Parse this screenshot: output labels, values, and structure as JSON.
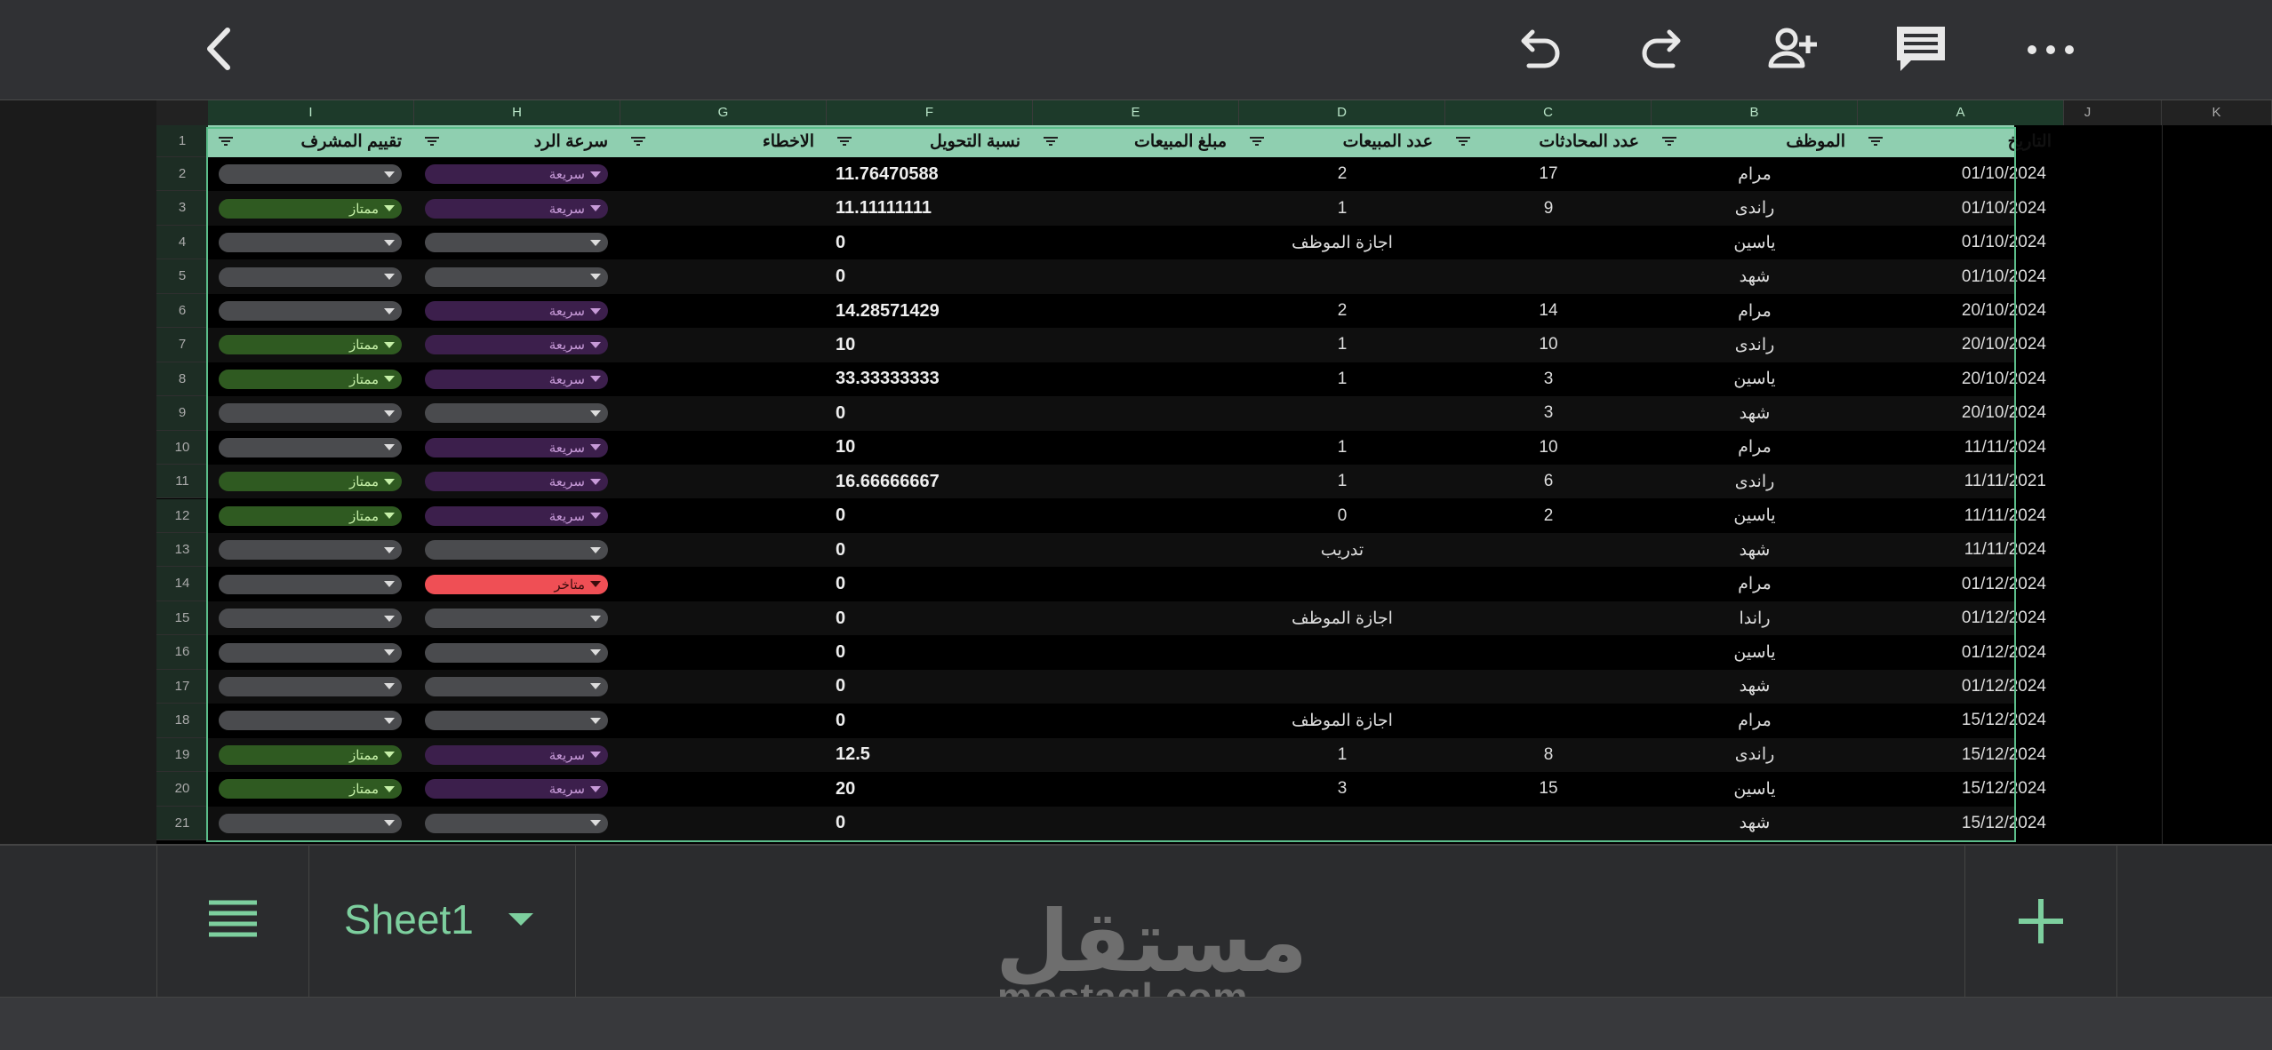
{
  "toolbar": {
    "icons": [
      "back-arrow-icon",
      "undo-icon",
      "redo-icon",
      "add-person-icon",
      "comment-icon",
      "more-icon"
    ]
  },
  "sheet": {
    "column_letters": [
      "A",
      "B",
      "C",
      "D",
      "E",
      "F",
      "G",
      "H",
      "I",
      "J",
      "K"
    ],
    "row_numbers": [
      "1",
      "2",
      "3",
      "4",
      "5",
      "6",
      "7",
      "8",
      "9",
      "10",
      "11",
      "12",
      "13",
      "14",
      "15",
      "16",
      "17",
      "18",
      "19",
      "20",
      "21"
    ],
    "headers": {
      "A": "التاريخ",
      "B": "الموظف",
      "C": "عدد المحادثات",
      "D": "عدد المبيعات",
      "E": "مبلغ المبيعات",
      "F": "نسبة التحويل",
      "G": "الاخطاء",
      "H": "سرعة الرد",
      "I": "تقييم المشرف"
    },
    "rows": [
      {
        "date": "01/10/2024",
        "employee": "مرام",
        "chats": "17",
        "sales": "2",
        "amount": "",
        "rate": "11.76470588",
        "errors": "",
        "speed": "سريعة",
        "rating": ""
      },
      {
        "date": "01/10/2024",
        "employee": "راندى",
        "chats": "9",
        "sales": "1",
        "amount": "",
        "rate": "11.11111111",
        "errors": "",
        "speed": "سريعة",
        "rating": "ممتاز"
      },
      {
        "date": "01/10/2024",
        "employee": "ياسين",
        "chats": "",
        "sales": "اجازة الموظف",
        "amount": "",
        "rate": "0",
        "errors": "",
        "speed": "",
        "rating": ""
      },
      {
        "date": "01/10/2024",
        "employee": "شهد",
        "chats": "",
        "sales": "",
        "amount": "",
        "rate": "0",
        "errors": "",
        "speed": "",
        "rating": ""
      },
      {
        "date": "20/10/2024",
        "employee": "مرام",
        "chats": "14",
        "sales": "2",
        "amount": "",
        "rate": "14.28571429",
        "errors": "",
        "speed": "سريعة",
        "rating": ""
      },
      {
        "date": "20/10/2024",
        "employee": "راندى",
        "chats": "10",
        "sales": "1",
        "amount": "",
        "rate": "10",
        "errors": "",
        "speed": "سريعة",
        "rating": "ممتاز"
      },
      {
        "date": "20/10/2024",
        "employee": "ياسين",
        "chats": "3",
        "sales": "1",
        "amount": "",
        "rate": "33.33333333",
        "errors": "",
        "speed": "سريعة",
        "rating": "ممتاز"
      },
      {
        "date": "20/10/2024",
        "employee": "شهد",
        "chats": "3",
        "sales": "",
        "amount": "",
        "rate": "0",
        "errors": "",
        "speed": "",
        "rating": ""
      },
      {
        "date": "11/11/2024",
        "employee": "مرام",
        "chats": "10",
        "sales": "1",
        "amount": "",
        "rate": "10",
        "errors": "",
        "speed": "سريعة",
        "rating": ""
      },
      {
        "date": "11/11/2021",
        "employee": "راندى",
        "chats": "6",
        "sales": "1",
        "amount": "",
        "rate": "16.66666667",
        "errors": "",
        "speed": "سريعة",
        "rating": "ممتاز"
      },
      {
        "date": "11/11/2024",
        "employee": "ياسين",
        "chats": "2",
        "sales": "0",
        "amount": "",
        "rate": "0",
        "errors": "",
        "speed": "سريعة",
        "rating": "ممتاز"
      },
      {
        "date": "11/11/2024",
        "employee": "شهد",
        "chats": "",
        "sales": "تدريب",
        "amount": "",
        "rate": "0",
        "errors": "",
        "speed": "",
        "rating": ""
      },
      {
        "date": "01/12/2024",
        "employee": "مرام",
        "chats": "",
        "sales": "",
        "amount": "",
        "rate": "0",
        "errors": "",
        "speed": "متاخر",
        "rating": ""
      },
      {
        "date": "01/12/2024",
        "employee": "راندا",
        "chats": "",
        "sales": "اجازة الموظف",
        "amount": "",
        "rate": "0",
        "errors": "",
        "speed": "",
        "rating": ""
      },
      {
        "date": "01/12/2024",
        "employee": "ياسين",
        "chats": "",
        "sales": "",
        "amount": "",
        "rate": "0",
        "errors": "",
        "speed": "",
        "rating": ""
      },
      {
        "date": "01/12/2024",
        "employee": "شهد",
        "chats": "",
        "sales": "",
        "amount": "",
        "rate": "0",
        "errors": "",
        "speed": "",
        "rating": ""
      },
      {
        "date": "15/12/2024",
        "employee": "مرام",
        "chats": "",
        "sales": "اجازة الموظف",
        "amount": "",
        "rate": "0",
        "errors": "",
        "speed": "",
        "rating": ""
      },
      {
        "date": "15/12/2024",
        "employee": "راندى",
        "chats": "8",
        "sales": "1",
        "amount": "",
        "rate": "12.5",
        "errors": "",
        "speed": "سريعة",
        "rating": "ممتاز"
      },
      {
        "date": "15/12/2024",
        "employee": "ياسين",
        "chats": "15",
        "sales": "3",
        "amount": "",
        "rate": "20",
        "errors": "",
        "speed": "سريعة",
        "rating": "ممتاز"
      },
      {
        "date": "15/12/2024",
        "employee": "شهد",
        "chats": "",
        "sales": "",
        "amount": "",
        "rate": "0",
        "errors": "",
        "speed": "",
        "rating": ""
      }
    ]
  },
  "bottom": {
    "sheet_tab": "Sheet1",
    "watermark_ar": "مستقل",
    "watermark_en": "mostaql.com"
  },
  "colors": {
    "header_fill": "#8fcfb0",
    "accent_green": "#7dcf9e",
    "chip_fast": "#3c1f4c",
    "chip_late": "#ef4f55",
    "chip_excellent": "#2f5a21"
  }
}
